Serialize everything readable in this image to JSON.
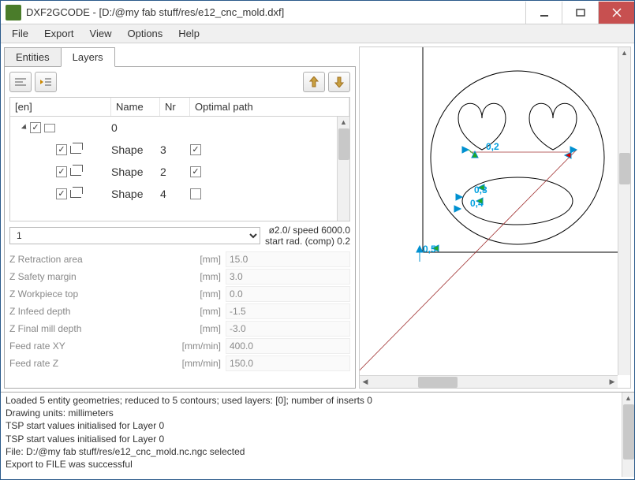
{
  "window": {
    "title": "DXF2GCODE - [D:/@my fab stuff/res/e12_cnc_mold.dxf]"
  },
  "menu": [
    "File",
    "Export",
    "View",
    "Options",
    "Help"
  ],
  "tabs": {
    "entities": "Entities",
    "layers": "Layers",
    "active": "layers"
  },
  "tree": {
    "headers": {
      "en": "[en]",
      "name": "Name",
      "nr": "Nr",
      "opt": "Optimal path"
    },
    "layer": {
      "name": "0"
    },
    "rows": [
      {
        "name": "Shape",
        "nr": "3",
        "opt": true
      },
      {
        "name": "Shape",
        "nr": "2",
        "opt": true
      },
      {
        "name": "Shape",
        "nr": "4",
        "opt": false
      }
    ]
  },
  "combo": {
    "value": "1",
    "info1": "ø2.0/ speed 6000.0",
    "info2": "start rad. (comp) 0.2"
  },
  "params": [
    {
      "label": "Z Retraction area",
      "unit": "[mm]",
      "value": "15.0"
    },
    {
      "label": "Z Safety margin",
      "unit": "[mm]",
      "value": "3.0"
    },
    {
      "label": "Z Workpiece top",
      "unit": "[mm]",
      "value": "0.0"
    },
    {
      "label": "Z Infeed depth",
      "unit": "[mm]",
      "value": "-1.5"
    },
    {
      "label": "Z Final mill depth",
      "unit": "[mm]",
      "value": "-3.0"
    },
    {
      "label": "Feed rate XY",
      "unit": "[mm/min]",
      "value": "400.0"
    },
    {
      "label": "Feed rate Z",
      "unit": "[mm/min]",
      "value": "150.0"
    }
  ],
  "markers": [
    "0,2",
    "0,3",
    "0,4",
    "0,5"
  ],
  "console": [
    "Loaded 5 entity geometries; reduced to 5 contours; used layers: [0]; number of inserts 0",
    "Drawing units: millimeters",
    "TSP start values initialised for Layer 0",
    "TSP start values initialised for Layer 0",
    "File: D:/@my fab stuff/res/e12_cnc_mold.nc.ngc selected",
    "Export to FILE was successful"
  ]
}
